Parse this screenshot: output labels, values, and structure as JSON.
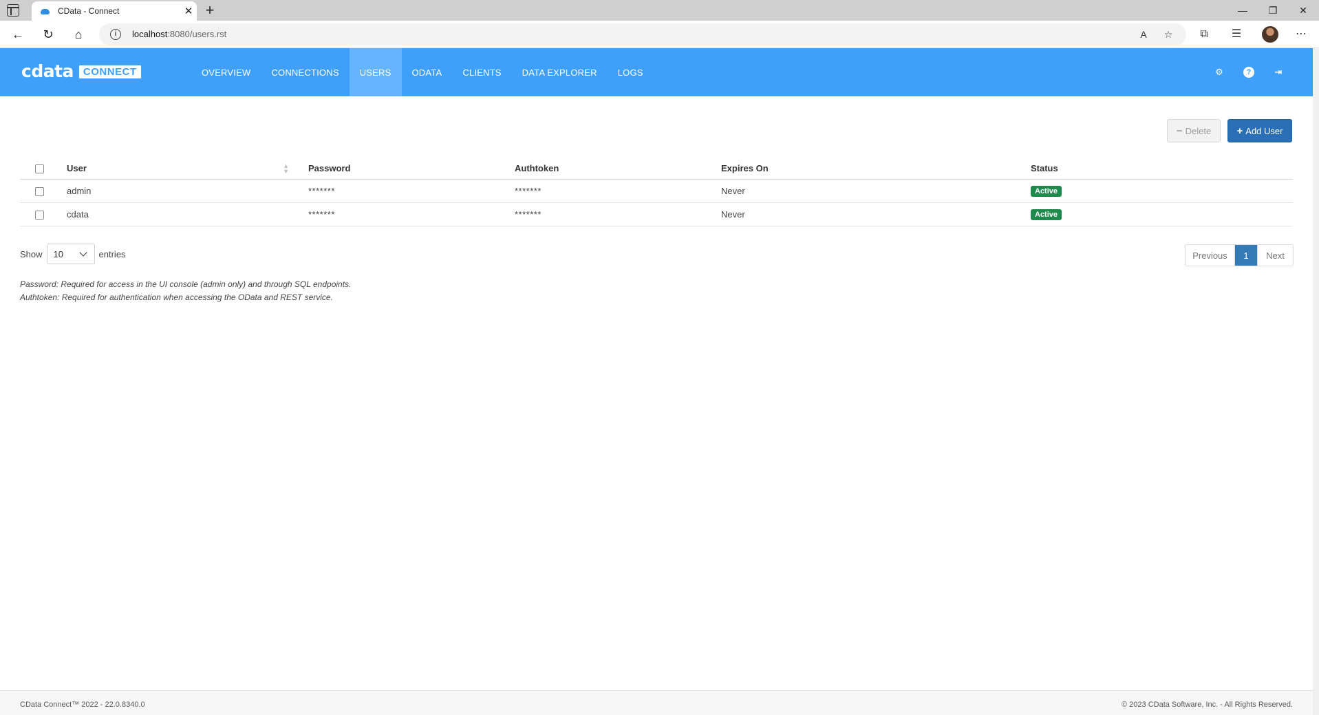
{
  "browser": {
    "tab_title": "CData - Connect",
    "url_host": "localhost",
    "url_rest": ":8080/users.rst"
  },
  "header": {
    "logo_word": "cdata",
    "logo_badge": "CONNECT",
    "nav": [
      {
        "label": "OVERVIEW",
        "active": false
      },
      {
        "label": "CONNECTIONS",
        "active": false
      },
      {
        "label": "USERS",
        "active": true
      },
      {
        "label": "ODATA",
        "active": false
      },
      {
        "label": "CLIENTS",
        "active": false
      },
      {
        "label": "DATA EXPLORER",
        "active": false
      },
      {
        "label": "LOGS",
        "active": false
      }
    ],
    "icons": [
      "gear-icon",
      "help-icon",
      "logout-icon"
    ]
  },
  "actions": {
    "delete_label": "Delete",
    "add_label": "Add User"
  },
  "table": {
    "columns": [
      "User",
      "Password",
      "Authtoken",
      "Expires On",
      "Status"
    ],
    "rows": [
      {
        "user": "admin",
        "password": "*******",
        "authtoken": "*******",
        "expires": "Never",
        "status": "Active"
      },
      {
        "user": "cdata",
        "password": "*******",
        "authtoken": "*******",
        "expires": "Never",
        "status": "Active"
      }
    ]
  },
  "length_control": {
    "show_label": "Show",
    "selected": "10",
    "entries_label": "entries"
  },
  "pager": {
    "previous": "Previous",
    "current": "1",
    "next": "Next"
  },
  "notes": {
    "password": "Password: Required for access in the UI console (admin only) and through SQL endpoints.",
    "authtoken": "Authtoken: Required for authentication when accessing the OData and REST service."
  },
  "footer": {
    "left": "CData Connect™ 2022 - 22.0.8340.0",
    "right": "© 2023 CData Software, Inc. - All Rights Reserved."
  },
  "colors": {
    "header_bg": "#3fa0fc",
    "active_nav": "#64b5fd",
    "primary_button": "#2a6fb5",
    "active_badge": "#1e8a4c",
    "pager_current": "#337ab7"
  }
}
